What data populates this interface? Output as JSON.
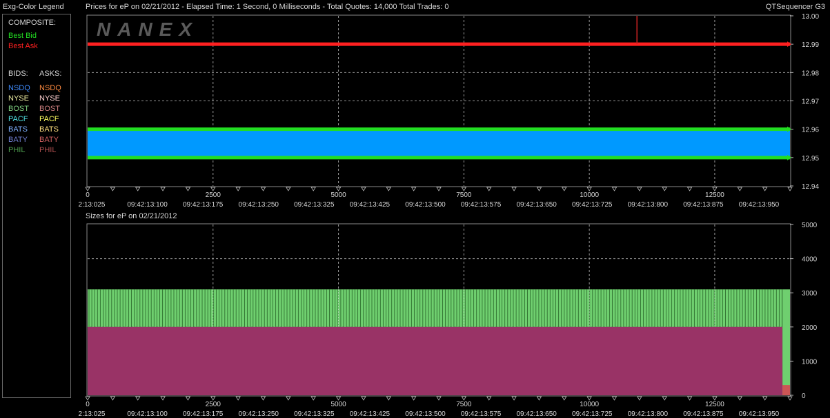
{
  "legend": {
    "title": "Exg-Color Legend",
    "composite_label": "COMPOSITE:",
    "best_bid": "Best Bid",
    "best_ask": "Best Ask",
    "bids_label": "BIDS:",
    "asks_label": "ASKS:",
    "exchanges": [
      "NSDQ",
      "NYSE",
      "BOST",
      "PACF",
      "BATS",
      "BATY",
      "PHIL"
    ],
    "bid_colors": [
      "#3f8cff",
      "#e8e8a0",
      "#7fcf7f",
      "#4fe0e0",
      "#7fb0ff",
      "#6f7fd0",
      "#4f9f4f"
    ],
    "ask_colors": [
      "#ff8a3f",
      "#ffd0d0",
      "#d08080",
      "#ffff60",
      "#ffe07f",
      "#d06060",
      "#b05050"
    ],
    "best_bid_color": "#22dd22",
    "best_ask_color": "#ff2020"
  },
  "header": {
    "prices_title": "Prices for  eP  on  02/21/2012  -  Elapsed Time: 1 Second, 0 Milliseconds  -  Total Quotes: 14,000  Total Trades: 0",
    "app_name": "QTSequencer G3",
    "sizes_title": "Sizes for  eP  on  02/21/2012",
    "watermark": "NANEX"
  },
  "chart_data": [
    {
      "type": "area",
      "title": "Prices for  eP  on  02/21/2012",
      "x_range": [
        0,
        14000
      ],
      "ylim": [
        12.94,
        13.0
      ],
      "y_ticks": [
        "13.00",
        "12.99",
        "12.98",
        "12.97",
        "12.96",
        "12.95",
        "12.94"
      ],
      "x_ticks_top": [
        "0",
        "2500",
        "5000",
        "7500",
        "10000",
        "12500"
      ],
      "x_ticks_bottom": [
        "2:13:025",
        "09:42:13:100",
        "09:42:13:175",
        "09:42:13:250",
        "09:42:13:325",
        "09:42:13:425",
        "09:42:13:500",
        "09:42:13:575",
        "09:42:13:650",
        "09:42:13:725",
        "09:42:13:800",
        "09:42:13:875",
        "09:42:13:950"
      ],
      "grid": true,
      "series": [
        {
          "name": "Best Ask",
          "color": "#ff2020",
          "value": 12.99
        },
        {
          "name": "Best Bid",
          "color": "#22dd22",
          "value": 12.96
        },
        {
          "color": "#22dd22",
          "value": 12.95
        },
        {
          "color": "#0099ff",
          "band": [
            12.95,
            12.96
          ]
        }
      ],
      "spike": {
        "x": 10950,
        "from": 12.99,
        "to": 13.0,
        "color": "#cc2222"
      }
    },
    {
      "type": "bar",
      "title": "Sizes for  eP  on  02/21/2012",
      "x_range": [
        0,
        14000
      ],
      "ylim": [
        0,
        5000
      ],
      "y_ticks": [
        "5000",
        "4000",
        "3000",
        "2000",
        "1000",
        "0"
      ],
      "x_ticks_top": [
        "0",
        "2500",
        "5000",
        "7500",
        "10000",
        "12500"
      ],
      "x_ticks_bottom": [
        "2:13:025",
        "09:42:13:100",
        "09:42:13:175",
        "09:42:13:250",
        "09:42:13:325",
        "09:42:13:425",
        "09:42:13:500",
        "09:42:13:575",
        "09:42:13:650",
        "09:42:13:725",
        "09:42:13:800",
        "09:42:13:875",
        "09:42:13:950"
      ],
      "grid": true,
      "series": [
        {
          "color": "#6fcf6f",
          "value": 3100
        },
        {
          "color": "#993366",
          "value": 2000
        }
      ],
      "tail": {
        "x_start": 13850,
        "green_value": 3100,
        "red_value": 300,
        "red_color": "#cc5555"
      }
    }
  ]
}
